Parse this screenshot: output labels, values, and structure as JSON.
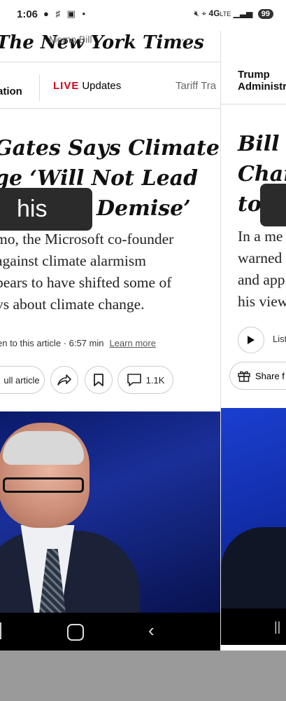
{
  "status_bar": {
    "time": "1:06",
    "left_icons": "● ♯ ▣ •",
    "network": "4G",
    "network_suffix": "LTE",
    "battery": "99"
  },
  "left_article": {
    "masthead": "The New York Times",
    "masthead_overlap": "Memo    Bill",
    "masthead_menu": "…",
    "section_tab_partial": "ation",
    "live_label": "LIVE",
    "live_text": "Updates",
    "tariff_tab": "Tariff Tra",
    "headline_lines": [
      "Gates Says Climate",
      "ge ‘Will Not Lead",
      "Demise’"
    ],
    "tooltip_text": "his",
    "summary_lines": [
      "mo, the Microsoft co-founder",
      " against climate alarmism",
      "pears to have shifted some of",
      "vs about climate change."
    ],
    "listen_text": "en to this article · 6:57 min",
    "learn_more": "Learn more",
    "full_article_button": "ull article",
    "comments_count": "1.1K"
  },
  "right_article": {
    "section_tab": [
      "Trump",
      "Administr"
    ],
    "headline_lines": [
      "Bill G",
      "Char",
      "to"
    ],
    "summary_lines": [
      "In a me",
      "warned",
      "and app",
      "his view"
    ],
    "listen_partial": "List",
    "share_partial": "Share f",
    "nav_recents": "||"
  }
}
